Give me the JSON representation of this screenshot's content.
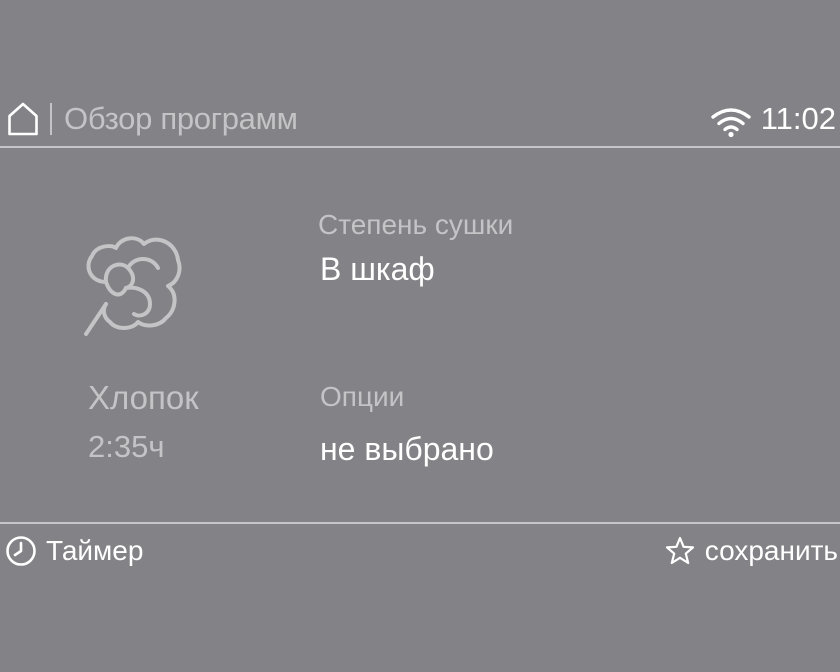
{
  "header": {
    "home_icon": "home-icon",
    "title": "Обзор программ",
    "wifi_icon": "wifi-icon",
    "time": "11:02"
  },
  "program": {
    "icon": "cotton-icon",
    "name": "Хлопок",
    "duration": "2:35ч"
  },
  "settings": {
    "dryness_label": "Степень сушки",
    "dryness_value": "В шкаф",
    "options_label": "Опции",
    "options_value": "не выбрано"
  },
  "footer": {
    "timer_icon": "clock-icon",
    "timer_label": "Таймер",
    "save_icon": "star-icon",
    "save_label": "сохранить"
  },
  "colors": {
    "background": "#838286",
    "primary_text": "#ffffff",
    "secondary_text": "#c4c3c6",
    "divider": "#c6c5c8"
  }
}
